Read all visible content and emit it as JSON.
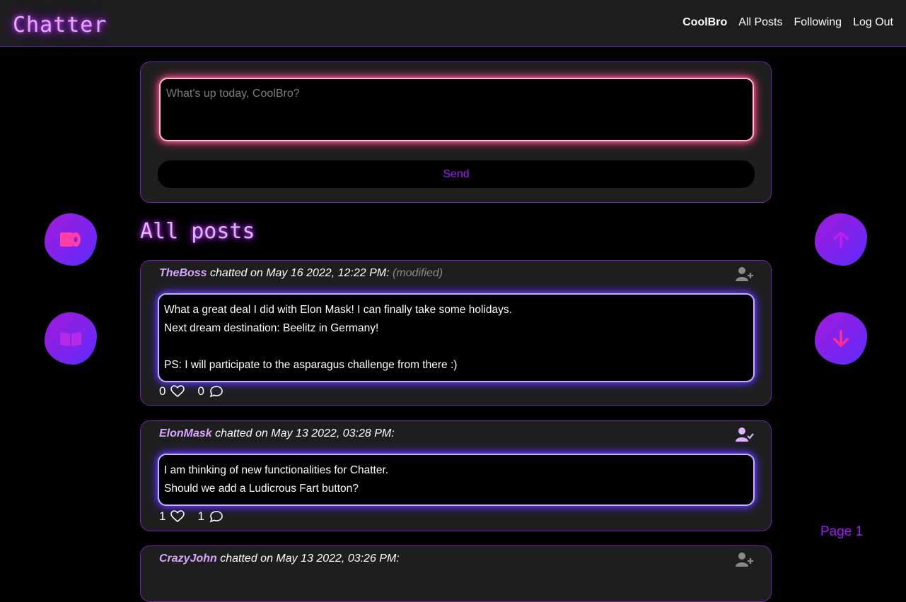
{
  "navbar": {
    "brand": "Chatter",
    "user": "CoolBro",
    "links": [
      "All Posts",
      "Following",
      "Log Out"
    ]
  },
  "composer": {
    "placeholder": "What's up today, CoolBro?",
    "send_label": "Send"
  },
  "section_title": "All posts",
  "side_buttons": {
    "left": [
      "toilet-paper-icon",
      "book-icon"
    ],
    "right": [
      "arrow-up-icon",
      "arrow-down-icon"
    ]
  },
  "posts": [
    {
      "author": "TheBoss",
      "meta": " chatted on May 16 2022, 12:22 PM:",
      "modified": "(modified)",
      "follow_icon": "user-plus-icon",
      "lines": [
        "What a great deal I did with Elon Mask! I can finally take some holidays.",
        "Next dream destination: Beelitz in Germany!",
        "",
        "PS: I will participate to the asparagus challenge from there :)"
      ],
      "likes": "0",
      "comments": "0"
    },
    {
      "author": "ElonMask",
      "meta": " chatted on May 13 2022, 03:28 PM:",
      "modified": "",
      "follow_icon": "user-check-icon",
      "lines": [
        "I am thinking of new functionalities for Chatter.",
        "Should we add a Ludicrous Fart button?"
      ],
      "likes": "1",
      "comments": "1"
    },
    {
      "author": "CrazyJohn",
      "meta": " chatted on May 13 2022, 03:26 PM:",
      "modified": "",
      "follow_icon": "user-plus-icon"
    }
  ],
  "pagination": {
    "label": "Page 1"
  },
  "colors": {
    "accent": "#a617ff",
    "border": "#7a1fb3",
    "panel": "#1e1e1e",
    "author": "#d8a6ff",
    "pink_glow": "#ff5f9e",
    "blue_glow": "#6d3dff"
  }
}
